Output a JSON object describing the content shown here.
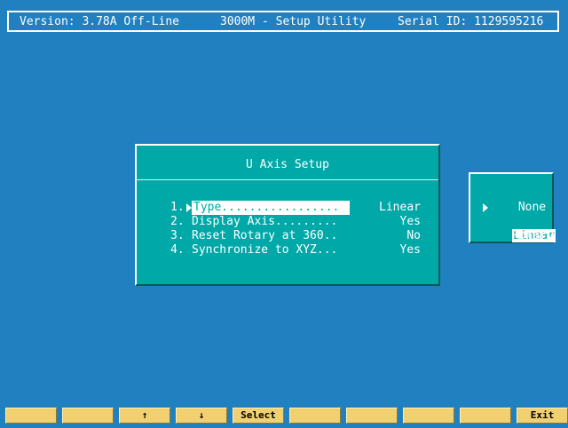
{
  "header": {
    "version": "Version: 3.78A Off-Line",
    "title": "3000M - Setup Utility",
    "serial": "Serial ID: 1129595216"
  },
  "dialog": {
    "title": "U Axis Setup",
    "options": [
      {
        "num": "1.",
        "label": "Type.................",
        "value": "Linear",
        "selected": true
      },
      {
        "num": "2.",
        "label": "Display Axis.........",
        "value": "Yes"
      },
      {
        "num": "3.",
        "label": "Reset Rotary at 360..",
        "value": "No"
      },
      {
        "num": "4.",
        "label": "Synchronize to XYZ...",
        "value": "Yes"
      }
    ]
  },
  "popup": {
    "items": [
      "None",
      "Linear",
      "Rotary"
    ],
    "selected": "Linear"
  },
  "fkeys": [
    "",
    "",
    "↑",
    "↓",
    "Select",
    "",
    "",
    "",
    "",
    "Exit"
  ],
  "colors": {
    "background": "#2080c0",
    "panel": "#00a8a8",
    "fkey": "#f0d070",
    "text": "#ffffff"
  }
}
